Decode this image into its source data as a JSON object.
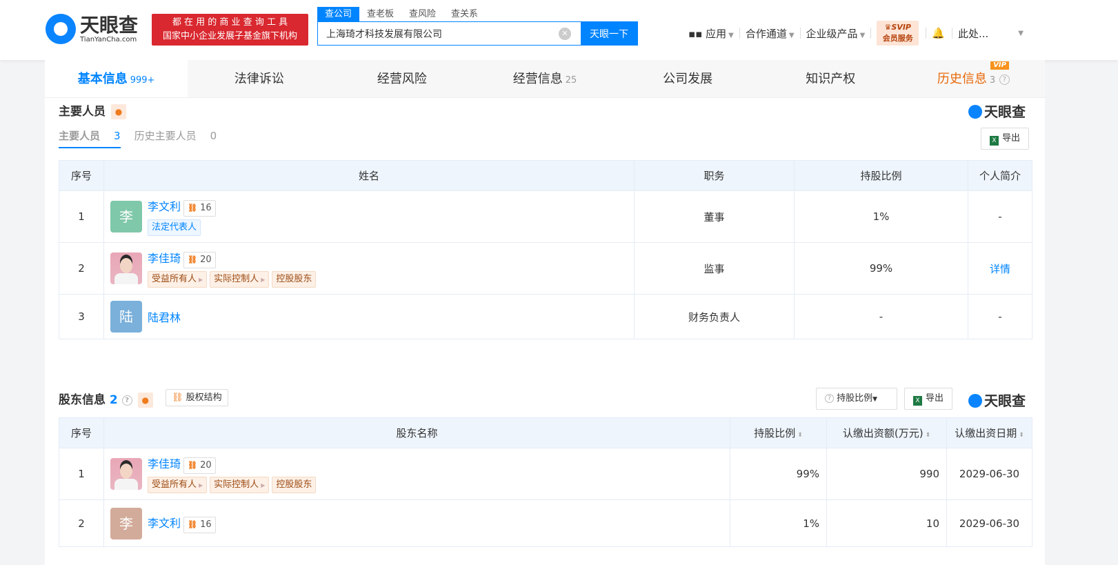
{
  "header": {
    "logo": "天眼查",
    "logo_url_text": "TianYanCha.com",
    "slogan_line1": "都 在 用 的 商 业 查 询 工 具",
    "slogan_line2": "国家中小企业发展子基金旗下机构",
    "search_tabs": [
      "查公司",
      "查老板",
      "查风险",
      "查关系"
    ],
    "search_value": "上海琦才科技发展有限公司",
    "search_button": "天眼一下",
    "nav": [
      "应用",
      "合作通道",
      "企业级产品"
    ],
    "svip_top": "SVIP",
    "svip_bottom": "会员服务",
    "user": "此处..."
  },
  "tabs": [
    {
      "label": "基本信息",
      "count": "999+"
    },
    {
      "label": "法律诉讼",
      "count": ""
    },
    {
      "label": "经营风险",
      "count": ""
    },
    {
      "label": "经营信息",
      "count": "25"
    },
    {
      "label": "公司发展",
      "count": ""
    },
    {
      "label": "知识产权",
      "count": ""
    },
    {
      "label": "历史信息",
      "count": "3",
      "badge": "VIP"
    }
  ],
  "personnel": {
    "title": "主要人员",
    "brand": "天眼查",
    "subtab_current": "主要人员",
    "subtab_current_count": "3",
    "subtab_history": "历史主要人员",
    "subtab_history_count": "0",
    "export": "导出",
    "columns": [
      "序号",
      "姓名",
      "职务",
      "持股比例",
      "个人简介"
    ],
    "rows": [
      {
        "no": "1",
        "avatar": "李",
        "name": "李文利",
        "relations": "16",
        "tags": [
          "法定代表人"
        ],
        "role": "董事",
        "share": "1%",
        "bio": "-"
      },
      {
        "no": "2",
        "name": "李佳琦",
        "relations": "20",
        "tags": [
          "受益所有人",
          "实际控制人",
          "控股股东"
        ],
        "role": "监事",
        "share": "99%",
        "bio": "详情"
      },
      {
        "no": "3",
        "avatar": "陆",
        "name": "陆君林",
        "role": "财务负责人",
        "share": "-",
        "bio": "-"
      }
    ]
  },
  "shareholders": {
    "title": "股东信息",
    "count": "2",
    "equity_button": "股权结构",
    "filter": "持股比例",
    "export": "导出",
    "brand": "天眼查",
    "columns": [
      "序号",
      "股东名称",
      "持股比例",
      "认缴出资额(万元)",
      "认缴出资日期"
    ],
    "rows": [
      {
        "no": "1",
        "name": "李佳琦",
        "relations": "20",
        "tags": [
          "受益所有人",
          "实际控制人",
          "控股股东"
        ],
        "share": "99%",
        "amount": "990",
        "date": "2029-06-30"
      },
      {
        "no": "2",
        "avatar": "李",
        "name": "李文利",
        "relations": "16",
        "share": "1%",
        "amount": "10",
        "date": "2029-06-30"
      }
    ]
  }
}
